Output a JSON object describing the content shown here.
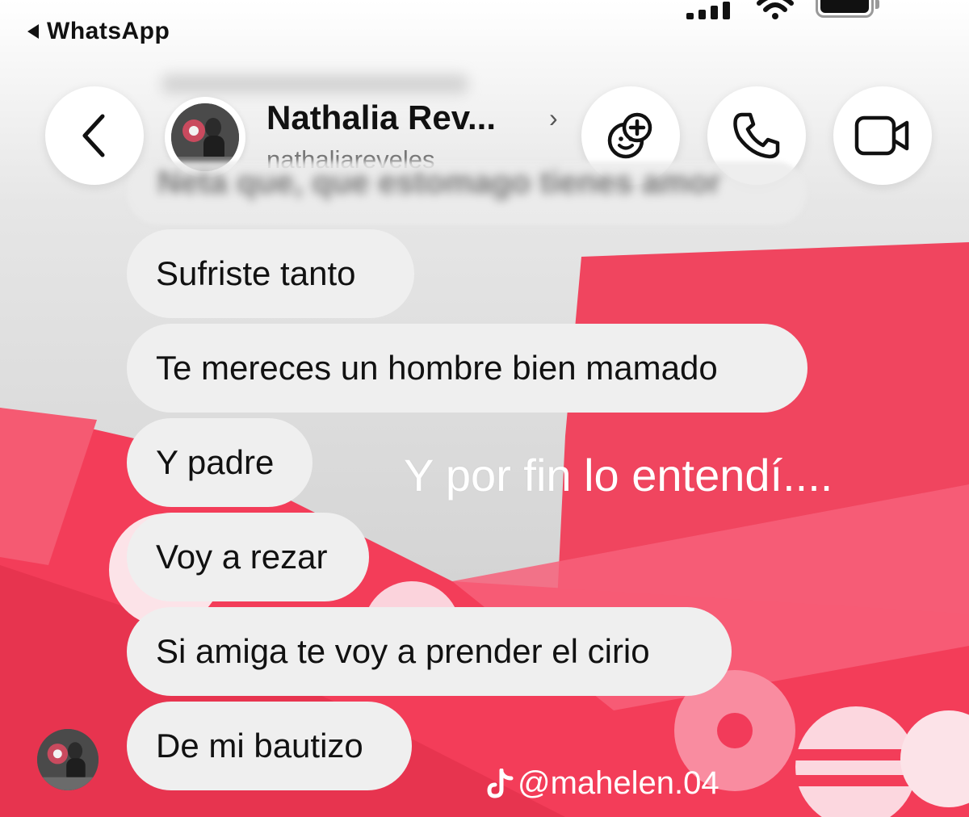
{
  "status_bar": {
    "back_app_label": "WhatsApp",
    "signal_icon": "cellular-signal-icon",
    "wifi_icon": "wifi-icon",
    "battery_icon": "battery-icon"
  },
  "header": {
    "back_icon": "chevron-left-icon",
    "contact_name": "Nathalia Rev...",
    "username": "nathaliareveles",
    "chevron": "›",
    "actions": [
      {
        "name": "add-friend-button",
        "icon": "people-plus-icon"
      },
      {
        "name": "audio-call-button",
        "icon": "phone-icon"
      },
      {
        "name": "video-call-button",
        "icon": "video-camera-icon"
      }
    ]
  },
  "messages": {
    "faded_partial": "Neta que, que estomago tienes amor",
    "items": [
      {
        "text": "Sufriste tanto"
      },
      {
        "text": "Te mereces un hombre bien mamado"
      },
      {
        "text": "Y padre"
      },
      {
        "text": "Voy a rezar"
      },
      {
        "text": "Si amiga te voy a prender el cirio"
      },
      {
        "text": "De mi bautizo"
      }
    ]
  },
  "overlay": {
    "caption": "Y por fin lo entendí....",
    "watermark": "@mahelen.04",
    "watermark_icon": "tiktok-icon"
  },
  "colors": {
    "ribbon_red": "#f23b5a",
    "bubble_bg": "#efefef",
    "text_dark": "#111111"
  }
}
